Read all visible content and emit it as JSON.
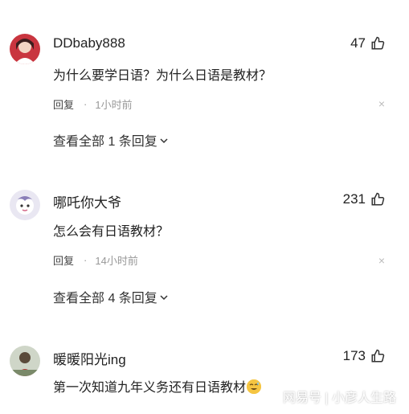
{
  "comments": [
    {
      "username": "DDbaby888",
      "likes": "47",
      "text": "为什么要学日语？为什么日语是教材？",
      "reply_label": "回复",
      "separator": "·",
      "time": "1小时前",
      "view_all": "查看全部 1 条回复"
    },
    {
      "username": "哪吒你大爷",
      "likes": "231",
      "text": "怎么会有日语教材？",
      "reply_label": "回复",
      "separator": "·",
      "time": "14小时前",
      "view_all": "查看全部 4 条回复"
    },
    {
      "username": "暖暖阳光ing",
      "likes": "173",
      "text": "第一次知道九年义务还有日语教材",
      "emoji": "grinning-sweat-emoji"
    }
  ],
  "close_glyph": "×",
  "watermark": "网易号 | 小彦人生路"
}
